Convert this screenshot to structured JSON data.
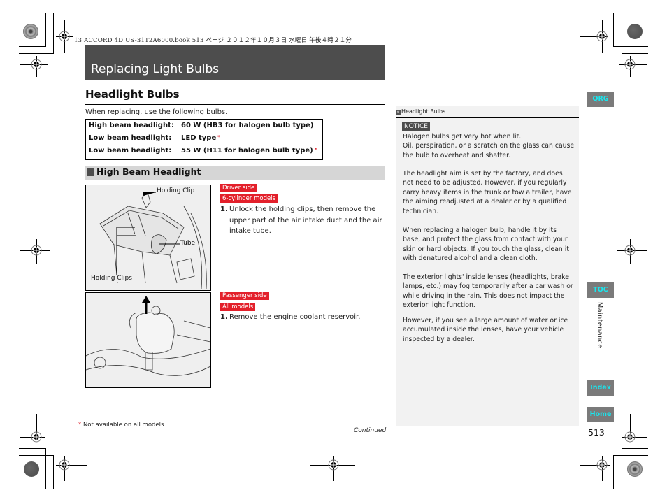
{
  "print_header": "13 ACCORD 4D US-31T2A6000.book  513 ページ  ２０１２年１０月３日  水曜日  午後４時２１分",
  "page": {
    "title": "Replacing Light Bulbs",
    "section_title": "Headlight Bulbs",
    "intro": "When replacing, use the following bulbs.",
    "specs": [
      {
        "label": "High beam headlight:",
        "value": "60 W (HB3 for halogen bulb type)",
        "asterisk": false
      },
      {
        "label": "Low beam headlight:",
        "value": "LED type",
        "asterisk": true
      },
      {
        "label": "Low beam headlight:",
        "value": "55 W (H11 for halogen bulb type)",
        "asterisk": true
      }
    ],
    "asterisk_symbol": "*",
    "subsection_title": "High Beam Headlight",
    "procedures": [
      {
        "tags": [
          "Driver side",
          "6-cylinder models"
        ],
        "step_number": "1.",
        "step_text": "Unlock the holding clips, then remove the upper part of the air intake duct and the air intake tube.",
        "figure_labels": [
          "Holding Clip",
          "Tube",
          "Holding Clips"
        ]
      },
      {
        "tags": [
          "Passenger side",
          "All models"
        ],
        "step_number": "1.",
        "step_text": "Remove the engine coolant reservoir.",
        "figure_labels": []
      }
    ],
    "footnote": "Not available on all models",
    "continued": "Continued",
    "page_number": "513"
  },
  "sidebar_note": {
    "heading": "Headlight Bulbs",
    "notice_label": "NOTICE",
    "paragraphs": [
      "Halogen bulbs get very hot when lit.\nOil, perspiration, or a scratch on the glass can cause the bulb to overheat and shatter.",
      "The headlight aim is set by the factory, and does not need to be adjusted. However, if you regularly carry heavy items in the trunk or tow a trailer, have the aiming readjusted at a dealer or by a qualified technician.",
      "When replacing a halogen bulb, handle it by its base, and protect the glass from contact with your skin or hard objects. If you touch the glass, clean it with denatured alcohol and a clean cloth.",
      "The exterior lights' inside lenses (headlights, brake lamps, etc.) may fog temporarily after a car wash or while driving in the rain. This does not impact the exterior light function.",
      "However, if you see a large amount of water or ice accumulated inside the lenses, have your vehicle inspected by a dealer."
    ]
  },
  "nav": {
    "qrg": "QRG",
    "toc": "TOC",
    "chapter": "Maintenance",
    "index": "Index",
    "home": "Home",
    "button_text_color": "#19e6ee",
    "button_bg": "#7a7a7a"
  },
  "colors": {
    "title_bar": "#4d4d4d",
    "tag_red": "#e3202b",
    "sidebar_bg": "#f2f2f2",
    "section_bar": "#d6d6d6"
  }
}
